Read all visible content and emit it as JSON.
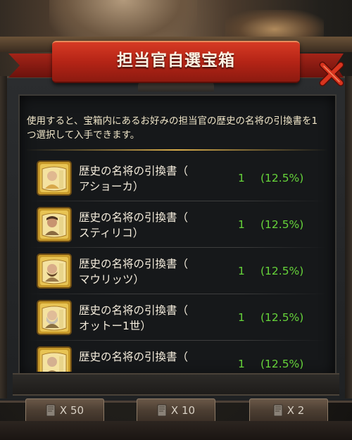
{
  "dialog": {
    "title": "担当官自選宝箱",
    "description": "使用すると、宝箱内にあるお好みの担当官の歴史の名将の引換書を1つ選択して入手できます。",
    "close_icon": "close-x-icon"
  },
  "items": [
    {
      "name_line1": "歴史の名将の引換書（",
      "name_line2": "アショーカ）",
      "qty": "1",
      "pct": "(12.5%)",
      "icon": "voucher-portrait-icon"
    },
    {
      "name_line1": "歴史の名将の引換書（",
      "name_line2": "スティリコ）",
      "qty": "1",
      "pct": "(12.5%)",
      "icon": "voucher-portrait-icon"
    },
    {
      "name_line1": "歴史の名将の引換書（",
      "name_line2": "マウリッツ）",
      "qty": "1",
      "pct": "(12.5%)",
      "icon": "voucher-portrait-icon"
    },
    {
      "name_line1": "歴史の名将の引換書（",
      "name_line2": "オットー1世）",
      "qty": "1",
      "pct": "(12.5%)",
      "icon": "voucher-portrait-icon"
    },
    {
      "name_line1": "歴史の名将の引換書（",
      "name_line2": "",
      "qty": "1",
      "pct": "(12.5%)",
      "icon": "voucher-portrait-icon"
    }
  ],
  "buttons": {
    "open_50": "X 50",
    "open_10": "X 10",
    "open_2": "X 2"
  },
  "colors": {
    "ribbon": "#b42416",
    "value_green": "#66d43a",
    "gold": "#d8ac4a"
  }
}
